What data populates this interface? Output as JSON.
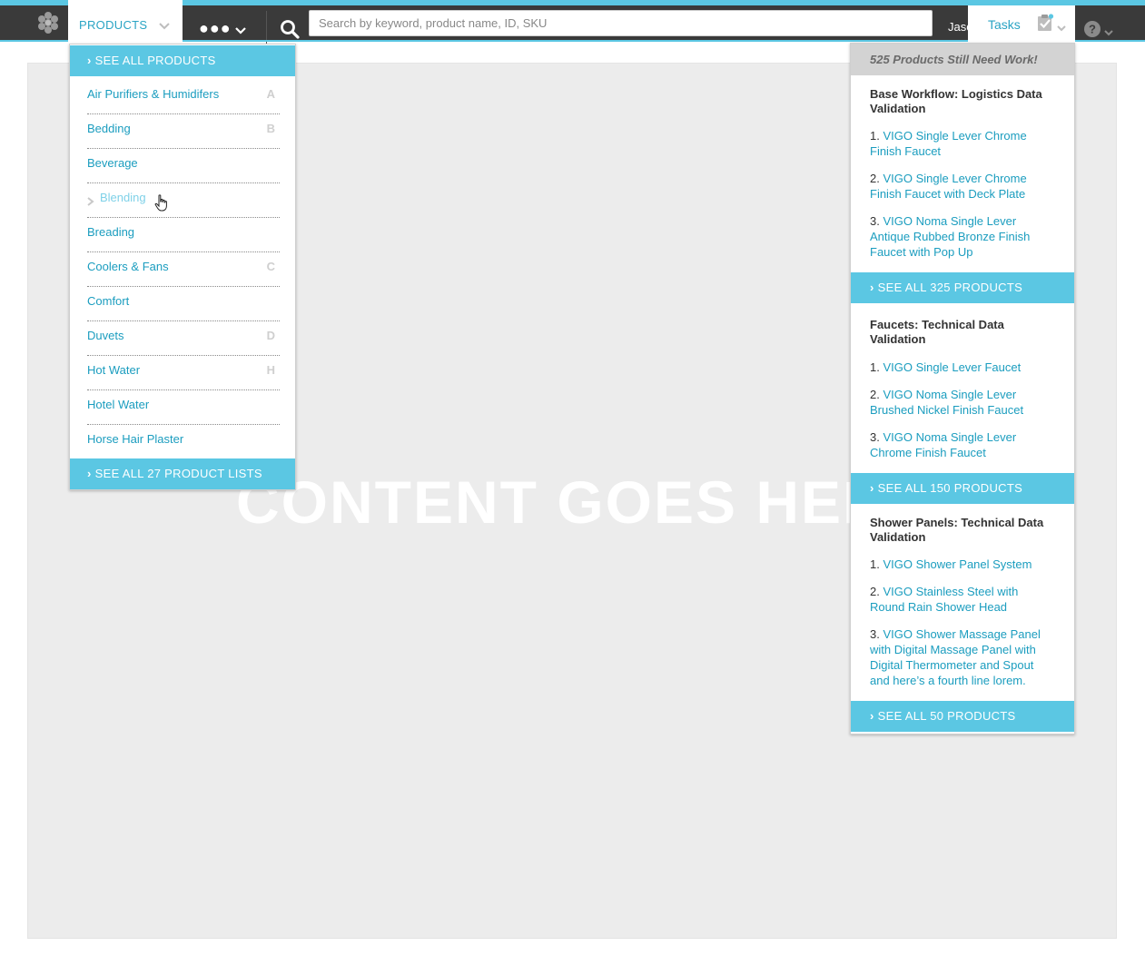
{
  "navbar": {
    "products_label": "PRODUCTS",
    "more_label": "●●●",
    "search_placeholder": "Search by keyword, product name, ID, SKU",
    "user_name": "Jason",
    "tasks_label": "Tasks"
  },
  "products_menu": {
    "see_all_label": "SEE ALL PRODUCTS",
    "items": [
      {
        "label": "Air Purifiers & Humidifers",
        "letter": "A"
      },
      {
        "label": "Bedding",
        "letter": "B"
      },
      {
        "label": "Beverage",
        "letter": ""
      },
      {
        "label": "Blending",
        "letter": ""
      },
      {
        "label": "Breading",
        "letter": ""
      },
      {
        "label": "Coolers & Fans",
        "letter": "C"
      },
      {
        "label": "Comfort",
        "letter": ""
      },
      {
        "label": "Duvets",
        "letter": "D"
      },
      {
        "label": "Hot Water",
        "letter": "H"
      },
      {
        "label": "Hotel Water",
        "letter": ""
      },
      {
        "label": "Horse Hair Plaster",
        "letter": ""
      }
    ],
    "see_all_lists_label": "SEE ALL 27 PRODUCT LISTS"
  },
  "content": {
    "placeholder_text": "CONTENT GOES HERE"
  },
  "tasks_menu": {
    "header": "525 Products Still Need Work!",
    "groups": [
      {
        "title": "Base Workflow: Logistics Data Validation",
        "items": [
          {
            "num": "1.",
            "label": "VIGO Single Lever Chrome Finish Faucet"
          },
          {
            "num": "2.",
            "label": "VIGO Single Lever Chrome Finish Faucet with Deck Plate"
          },
          {
            "num": "3.",
            "label": "VIGO Noma Single Lever Antique Rubbed Bronze Finish Faucet with Pop Up"
          }
        ],
        "see_all": "SEE ALL 325 PRODUCTS"
      },
      {
        "title": "Faucets: Technical Data Validation",
        "items": [
          {
            "num": "1.",
            "label": "VIGO Single Lever Faucet"
          },
          {
            "num": "2.",
            "label": "VIGO Noma Single Lever Brushed Nickel Finish Faucet"
          },
          {
            "num": "3.",
            "label": "VIGO Noma Single Lever Chrome Finish Faucet"
          }
        ],
        "see_all": "SEE ALL 150 PRODUCTS"
      },
      {
        "title": "Shower Panels: Technical Data Validation",
        "items": [
          {
            "num": "1.",
            "label": "VIGO Shower Panel System"
          },
          {
            "num": "2.",
            "label": "VIGO Stainless Steel with Round Rain Shower Head"
          },
          {
            "num": "3.",
            "label": "VIGO Shower Massage Panel with Digital Massage Panel with Digital Thermometer and Spout and here’s a fourth line lorem."
          }
        ],
        "see_all": "SEE ALL 50 PRODUCTS"
      }
    ]
  },
  "colors": {
    "accent": "#5bc7e3",
    "link": "#1b9dbf",
    "navbar": "#3a3a3a"
  }
}
